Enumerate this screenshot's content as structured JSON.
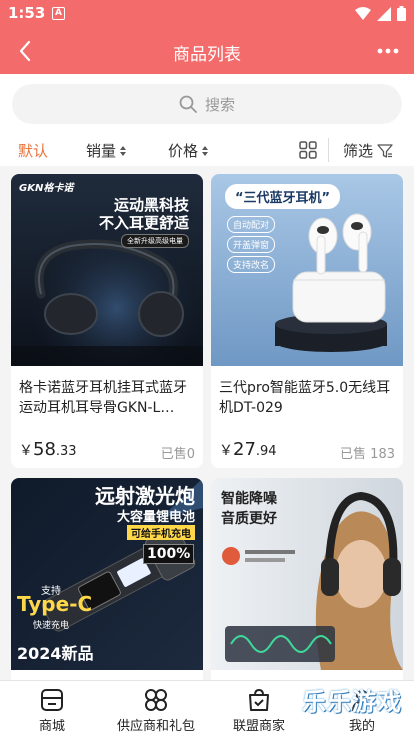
{
  "status_bar": {
    "time": "1:53",
    "notification": "A"
  },
  "nav": {
    "title": "商品列表"
  },
  "search": {
    "placeholder": "搜索"
  },
  "sort": {
    "default": "默认",
    "sales": "销量",
    "price": "价格",
    "filter": "筛选"
  },
  "products": [
    {
      "name": "格卡诺蓝牙耳机挂耳式蓝牙运动耳机耳导骨GKN-L…",
      "price_int": "58",
      "price_dec": ".33",
      "currency": "￥",
      "sold": "已售0",
      "banner": {
        "brand": "GKN格卡诺",
        "line1": "运动黑科技",
        "line2": "不入耳更舒适",
        "tag": "全新升级高级电量"
      }
    },
    {
      "name": "三代pro智能蓝牙5.0无线耳机DT-029",
      "price_int": "27",
      "price_dec": ".94",
      "currency": "￥",
      "sold": "已售 183",
      "banner": {
        "headline": "“三代蓝牙耳机”",
        "tags": [
          "自动配对",
          "开盖弹窗",
          "支持改名"
        ]
      }
    },
    {
      "name": "",
      "price_int": "",
      "price_dec": "",
      "currency": "",
      "sold": "",
      "banner": {
        "line1": "远射激光炮",
        "line2": "大容量锂电池",
        "tag": "可给手机充电",
        "display": "100%",
        "support": "支持",
        "typec": "Type-C",
        "fast": "快速充电",
        "year": "2024新品"
      }
    },
    {
      "name": "",
      "price_int": "",
      "price_dec": "",
      "currency": "",
      "sold": "",
      "banner": {
        "line1": "智能降噪",
        "line2": "音质更好"
      }
    }
  ],
  "tabs": [
    "商城",
    "供应商和礼包",
    "联盟商家",
    "我的"
  ],
  "watermark": "乐乐游戏",
  "colors": {
    "header": "#f36b6b",
    "accent": "#e8733a"
  }
}
